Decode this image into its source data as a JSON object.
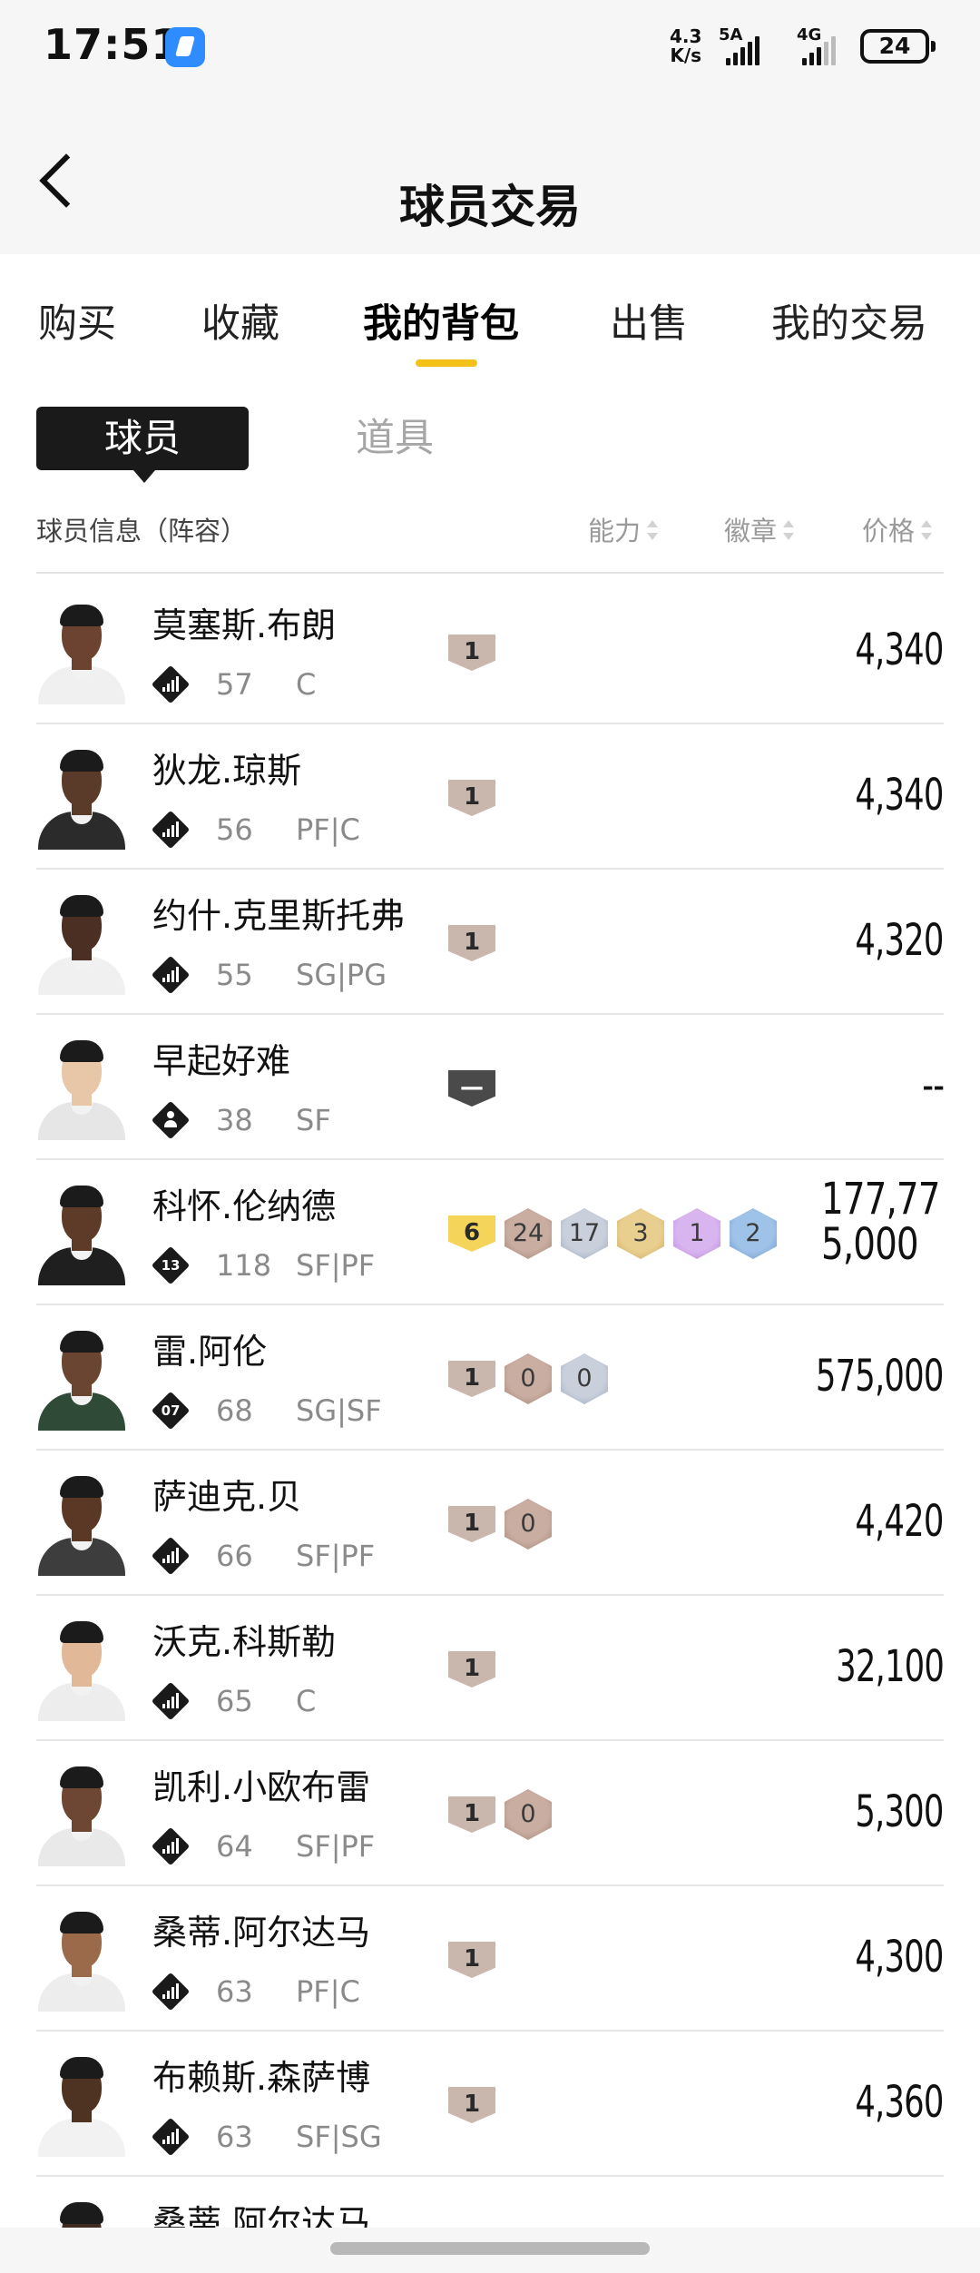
{
  "status_bar": {
    "time": "17:51",
    "net_speed_value": "4.3",
    "net_speed_unit": "K/s",
    "sim1_label": "5A",
    "sim2_label": "4G",
    "battery": "24"
  },
  "header": {
    "title": "球员交易"
  },
  "tabs": [
    {
      "label": "购买",
      "active": false
    },
    {
      "label": "收藏",
      "active": false
    },
    {
      "label": "我的背包",
      "active": true
    },
    {
      "label": "出售",
      "active": false
    },
    {
      "label": "我的交易",
      "active": false
    }
  ],
  "sub_tabs": [
    {
      "label": "球员",
      "active": true
    },
    {
      "label": "道具",
      "active": false
    }
  ],
  "columns": {
    "info": "球员信息（阵容）",
    "ability": "能力",
    "badges": "徽章",
    "price": "价格"
  },
  "colors": {
    "accent": "#f2c21b",
    "level_badge": "#c9b7ad",
    "level_badge_gold": "#f5d45a",
    "unknown_badge": "#4a4a4a"
  },
  "players": [
    {
      "name": "莫塞斯.布朗",
      "role_icon": "bars-icon",
      "rating": "57",
      "position": "C",
      "level": "1",
      "badges": [],
      "price": "4,340"
    },
    {
      "name": "狄龙.琼斯",
      "role_icon": "bars-icon",
      "rating": "56",
      "position": "PF|C",
      "level": "1",
      "badges": [],
      "price": "4,340"
    },
    {
      "name": "约什.克里斯托弗",
      "role_icon": "bars-icon",
      "rating": "55",
      "position": "SG|PG",
      "level": "1",
      "badges": [],
      "price": "4,320"
    },
    {
      "name": "早起好难",
      "role_icon": "person-icon",
      "rating": "38",
      "position": "SF",
      "level": "—",
      "badges": [],
      "price": "--"
    },
    {
      "name": "科怀.伦纳德",
      "role_icon": "number-icon",
      "role_number": "13",
      "rating": "118",
      "position": "SF|PF",
      "level": "6",
      "badges": [
        {
          "value": "24",
          "tier": "bronze"
        },
        {
          "value": "17",
          "tier": "silver"
        },
        {
          "value": "3",
          "tier": "gold"
        },
        {
          "value": "1",
          "tier": "purple"
        },
        {
          "value": "2",
          "tier": "blue"
        }
      ],
      "price": "177,775,000"
    },
    {
      "name": "雷.阿伦",
      "role_icon": "number-icon",
      "role_number": "07",
      "rating": "68",
      "position": "SG|SF",
      "level": "1",
      "badges": [
        {
          "value": "0",
          "tier": "bronze"
        },
        {
          "value": "0",
          "tier": "silver"
        }
      ],
      "price": "575,000"
    },
    {
      "name": "萨迪克.贝",
      "role_icon": "bars-icon",
      "rating": "66",
      "position": "SF|PF",
      "level": "1",
      "badges": [
        {
          "value": "0",
          "tier": "bronze"
        }
      ],
      "price": "4,420"
    },
    {
      "name": "沃克.科斯勒",
      "role_icon": "bars-icon",
      "rating": "65",
      "position": "C",
      "level": "1",
      "badges": [],
      "price": "32,100"
    },
    {
      "name": "凯利.小欧布雷",
      "role_icon": "bars-icon",
      "rating": "64",
      "position": "SF|PF",
      "level": "1",
      "badges": [
        {
          "value": "0",
          "tier": "bronze"
        }
      ],
      "price": "5,300"
    },
    {
      "name": "桑蒂.阿尔达马",
      "role_icon": "bars-icon",
      "rating": "63",
      "position": "PF|C",
      "level": "1",
      "badges": [],
      "price": "4,300"
    },
    {
      "name": "布赖斯.森萨博",
      "role_icon": "bars-icon",
      "rating": "63",
      "position": "SF|SG",
      "level": "1",
      "badges": [],
      "price": "4,360"
    },
    {
      "name": "桑蒂.阿尔达马",
      "role_icon": "bars-icon",
      "rating": "",
      "position": "",
      "level": "",
      "badges": [],
      "price": ""
    }
  ]
}
